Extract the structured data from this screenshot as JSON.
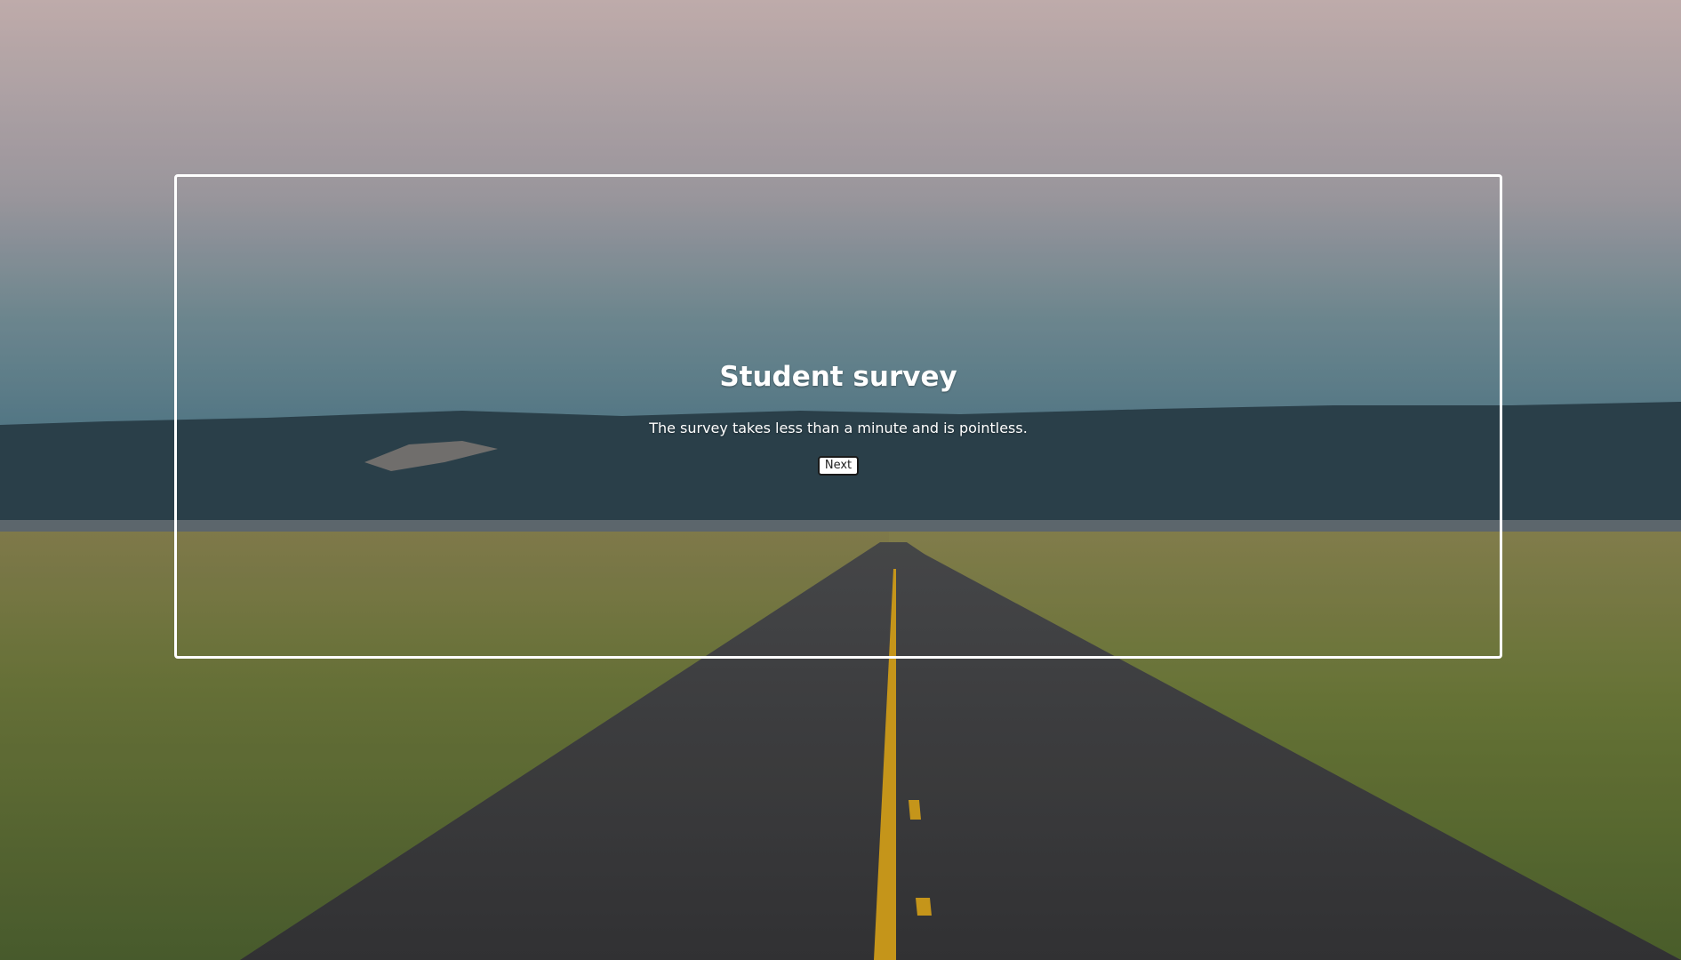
{
  "survey": {
    "title": "Student survey",
    "description": "The survey takes less than a minute and is pointless.",
    "next_label": "Next"
  },
  "background": {
    "subject": "open-road-prairie-landscape",
    "colors": {
      "sky_top": "#cdb8b8",
      "sky_mid": "#a9a6ad",
      "sky_low": "#5d8593",
      "hills": "#2f4550",
      "grass": "#7d7a45",
      "road": "#3b3a3b",
      "center_line": "#d8a21f"
    }
  },
  "frame": {
    "border_color": "#ffffff"
  }
}
